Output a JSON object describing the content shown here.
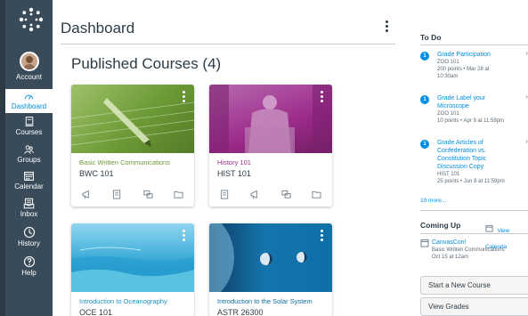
{
  "nav": {
    "account": "Account",
    "dashboard": "Dashboard",
    "courses": "Courses",
    "groups": "Groups",
    "calendar": "Calendar",
    "inbox": "Inbox",
    "history": "History",
    "help": "Help"
  },
  "header": {
    "title": "Dashboard"
  },
  "courses": {
    "heading": "Published Courses (4)",
    "cards": [
      {
        "name": "Basic Written Communications",
        "code": "BWC 101",
        "color": "#6c9a35"
      },
      {
        "name": "History 101",
        "code": "HIST 101",
        "color": "#9c2a8a"
      },
      {
        "name": "Introduction to Oceanography",
        "code": "OCE 101",
        "color": "#1a90c9"
      },
      {
        "name": "Introduction to the Solar System",
        "code": "ASTR 26300",
        "color": "#0e6fa7"
      }
    ]
  },
  "todo": {
    "heading": "To Do",
    "items": [
      {
        "badge": "1",
        "title": "Grade Participation",
        "course": "ZOO 101",
        "meta": "200 points • Mar 28 at 10:30am"
      },
      {
        "badge": "1",
        "title": "Grade Label your Microscope",
        "course": "ZOO 101",
        "meta": "10 points • Apr 9 at 11:59pm"
      },
      {
        "badge": "1",
        "title": "Grade Articles of Confederation vs. Constitution Topic Discussion Copy",
        "course": "HIST 101",
        "meta": "25 points • Jun 8 at 11:59pm"
      }
    ],
    "more": "10 more..."
  },
  "coming_up": {
    "heading": "Coming Up",
    "view_calendar": "View Calenda",
    "items": [
      {
        "title": "CanvasCon!",
        "course": "Basic Written Communications",
        "date": "Oct 15 at 12am"
      }
    ]
  },
  "buttons": {
    "new_course": "Start a New Course",
    "view_grades": "View Grades"
  },
  "colors": {
    "nav_bg": "#394b58",
    "link": "#008ee2"
  }
}
